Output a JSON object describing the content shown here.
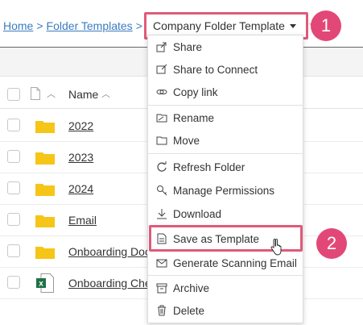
{
  "breadcrumb": {
    "home": "Home",
    "separator": ">",
    "folder_templates": "Folder Templates",
    "current": "Company Folder Template"
  },
  "callouts": [
    "1",
    "2"
  ],
  "list": {
    "header_name": "Name",
    "rows": [
      {
        "name": "2022",
        "type": "folder"
      },
      {
        "name": "2023",
        "type": "folder"
      },
      {
        "name": "2024",
        "type": "folder"
      },
      {
        "name": "Email",
        "type": "folder"
      },
      {
        "name": "Onboarding Doc",
        "type": "folder"
      },
      {
        "name": "Onboarding Che",
        "type": "xlsx"
      }
    ]
  },
  "menu": {
    "items": [
      {
        "label": "Share",
        "icon": "share-icon"
      },
      {
        "label": "Share to Connect",
        "icon": "share-connect-icon"
      },
      {
        "label": "Copy link",
        "icon": "link-icon"
      },
      {
        "label": "Rename",
        "icon": "rename-icon"
      },
      {
        "label": "Move",
        "icon": "move-icon"
      },
      {
        "label": "Refresh Folder",
        "icon": "refresh-icon"
      },
      {
        "label": "Manage Permissions",
        "icon": "key-icon"
      },
      {
        "label": "Download",
        "icon": "download-icon"
      },
      {
        "label": "Save as Template",
        "icon": "template-icon"
      },
      {
        "label": "Generate Scanning Email",
        "icon": "envelope-icon"
      },
      {
        "label": "Archive",
        "icon": "archive-icon"
      },
      {
        "label": "Delete",
        "icon": "trash-icon"
      }
    ]
  },
  "colors": {
    "link": "#3b7bc0",
    "highlight": "#e05a7a",
    "callout": "#e24877",
    "folder": "#f5c518",
    "excel": "#1e7145"
  }
}
